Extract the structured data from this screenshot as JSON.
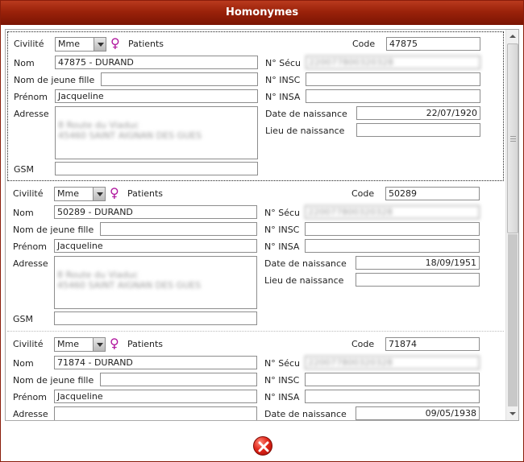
{
  "dialog": {
    "title": "Homonymes"
  },
  "labels": {
    "civilite": "Civilité",
    "patients": "Patients",
    "code": "Code",
    "nom": "Nom",
    "nom_jeune_fille": "Nom de jeune fille",
    "prenom": "Prénom",
    "adresse": "Adresse",
    "gsm": "GSM",
    "secu": "N° Sécu",
    "insc": "N° INSC",
    "insa": "N° INSA",
    "date_naissance": "Date de naissance",
    "lieu_naissance": "Lieu de naissance"
  },
  "records": [
    {
      "civilite": "Mme",
      "code": "47875",
      "nom": "47875 - DURAND",
      "nom_jeune_fille": "",
      "prenom": "Jacqueline",
      "adresse_line1": "8 Route du Viaduc",
      "adresse_line2": "45460 SAINT AIGNAN DES GUES",
      "gsm": "",
      "secu": "220077800320328",
      "insc": "",
      "insa": "",
      "date_naissance": "22/07/1920",
      "lieu_naissance": ""
    },
    {
      "civilite": "Mme",
      "code": "50289",
      "nom": "50289 - DURAND",
      "nom_jeune_fille": "",
      "prenom": "Jacqueline",
      "adresse_line1": "8 Route du Viaduc",
      "adresse_line2": "45460 SAINT AIGNAN DES GUES",
      "gsm": "",
      "secu": "220077800320328",
      "insc": "",
      "insa": "",
      "date_naissance": "18/09/1951",
      "lieu_naissance": ""
    },
    {
      "civilite": "Mme",
      "code": "71874",
      "nom": "71874 - DURAND",
      "nom_jeune_fille": "",
      "prenom": "Jacqueline",
      "adresse_line1": "",
      "adresse_line2": "",
      "gsm": "",
      "secu": "220077800320328",
      "insc": "",
      "insa": "",
      "date_naissance": "09/05/1938",
      "lieu_naissance": ""
    }
  ],
  "icons": {
    "female": "female-symbol-icon",
    "close": "close-icon"
  },
  "colors": {
    "title_bar": "#9b220a",
    "female_symbol": "#b0169e",
    "close_button": "#e2261a"
  }
}
